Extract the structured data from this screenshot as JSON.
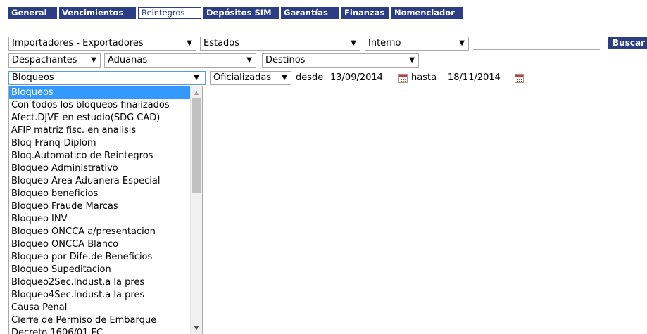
{
  "tabs": [
    "General",
    "Vencimientos",
    "Reintegros",
    "Depósitos SIM",
    "Garantías",
    "Finanzas",
    "Nomenclador"
  ],
  "active_tab": "Reintegros",
  "filters": {
    "importadores": "Importadores - Exportadores",
    "estados": "Estados",
    "interno": "Interno",
    "search_value": "",
    "buscar": "Buscar",
    "despachantes": "Despachantes",
    "aduanas": "Aduanas",
    "destinos": "Destinos",
    "bloqueos": "Bloqueos",
    "oficializadas": "Oficializadas",
    "desde_label": "desde",
    "desde_date": "13/09/2014",
    "hasta_label": "hasta",
    "hasta_date": "18/11/2014"
  },
  "dropdown": {
    "selected": "Bloqueos",
    "options": [
      "Bloqueos",
      "Con todos los bloqueos finalizados",
      "Afect.DJVE en estudio(SDG CAD)",
      "AFIP matriz fisc. en analisis",
      "Bloq-Franq-Diplom",
      "Bloq.Automatico de Reintegros",
      "Bloqueo Administrativo",
      "Bloqueo Area Aduanera Especial",
      "Bloqueo beneficios",
      "Bloqueo Fraude Marcas",
      "Bloqueo INV",
      "Bloqueo ONCCA a/presentacion",
      "Bloqueo ONCCA Blanco",
      "Bloqueo por Dife.de Beneficios",
      "Bloqueo Supeditacion",
      "Bloqueo2Sec.Indust.a la pres",
      "Bloqueo4Sec.Indust.a la pres",
      "Causa Penal",
      "Cierre de Permiso de Embarque",
      "Decreto 1606/01 FC"
    ]
  },
  "icons": {
    "dropdown_arrow": "▼",
    "calendar": "calendar-icon",
    "scroll_up": "▲",
    "scroll_down": "▼"
  },
  "colors": {
    "tab_bg": "#2b3d85",
    "highlight": "#3399ff",
    "calendar_red": "#d9322a"
  }
}
